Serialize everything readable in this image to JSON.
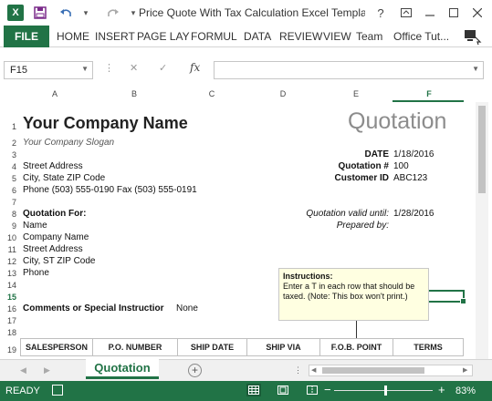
{
  "app": {
    "doc_title": "Price Quote With Tax Calculation Excel Templa...",
    "help_label": "?",
    "logo_label": "X"
  },
  "ribbon": {
    "file": "FILE",
    "tabs": [
      "HOME",
      "INSERT",
      "PAGE LAY",
      "FORMUL",
      "DATA",
      "REVIEW",
      "VIEW",
      "Team",
      "Office Tut..."
    ]
  },
  "formula_bar": {
    "name_box": "F15",
    "fx_label": "fx",
    "formula": ""
  },
  "columns": [
    "A",
    "B",
    "C",
    "D",
    "E",
    "F"
  ],
  "rows": [
    "1",
    "2",
    "3",
    "4",
    "5",
    "6",
    "7",
    "8",
    "9",
    "10",
    "11",
    "12",
    "13",
    "14",
    "15",
    "16",
    "17",
    "18",
    "19"
  ],
  "sheet": {
    "company_name": "Your Company Name",
    "slogan": "Your Company Slogan",
    "quotation_title": "Quotation",
    "street": "Street Address",
    "city": "City, State ZIP Code",
    "phone_fax": "Phone (503) 555-0190   Fax (503) 555-0191",
    "date_label": "DATE",
    "date_value": "1/18/2016",
    "quote_no_label": "Quotation #",
    "quote_no_value": "100",
    "customer_id_label": "Customer ID",
    "customer_id_value": "ABC123",
    "quotation_for": "Quotation For:",
    "name": "Name",
    "company": "Company Name",
    "street2": "Street Address",
    "city2": "City, ST  ZIP Code",
    "phone2": "Phone",
    "valid_until_label": "Quotation valid until:",
    "valid_until_value": "1/28/2016",
    "prepared_by_label": "Prepared by:",
    "comments_label": "Comments or Special Instructions:",
    "comments_label_shown": "Comments or Special Instructior",
    "comments_value": "None",
    "instructions_title": "Instructions:",
    "instructions_text": "Enter a T in each row that should be taxed.  (Note: This box won't print.)",
    "table_headers": [
      "SALESPERSON",
      "P.O. NUMBER",
      "SHIP DATE",
      "SHIP VIA",
      "F.O.B. POINT",
      "TERMS"
    ]
  },
  "sheet_tabs": {
    "active": "Quotation",
    "add": "+"
  },
  "status": {
    "ready": "READY",
    "zoom_minus": "−",
    "zoom_plus": "+",
    "zoom": "83%",
    "zoom_level": 0.83
  },
  "colors": {
    "excel_green": "#217346",
    "note_bg": "#ffffe1",
    "title_grey": "#8c8c8c"
  },
  "icons": [
    "excel-logo-icon",
    "save-icon",
    "undo-icon",
    "redo-icon",
    "customize-qat-icon",
    "help-icon",
    "ribbon-display-icon",
    "minimize-icon",
    "maximize-icon",
    "close-icon",
    "account-pc-icon",
    "cancel-icon",
    "enter-icon",
    "add-sheet-icon",
    "normal-view-icon",
    "page-layout-view-icon",
    "page-break-view-icon"
  ]
}
